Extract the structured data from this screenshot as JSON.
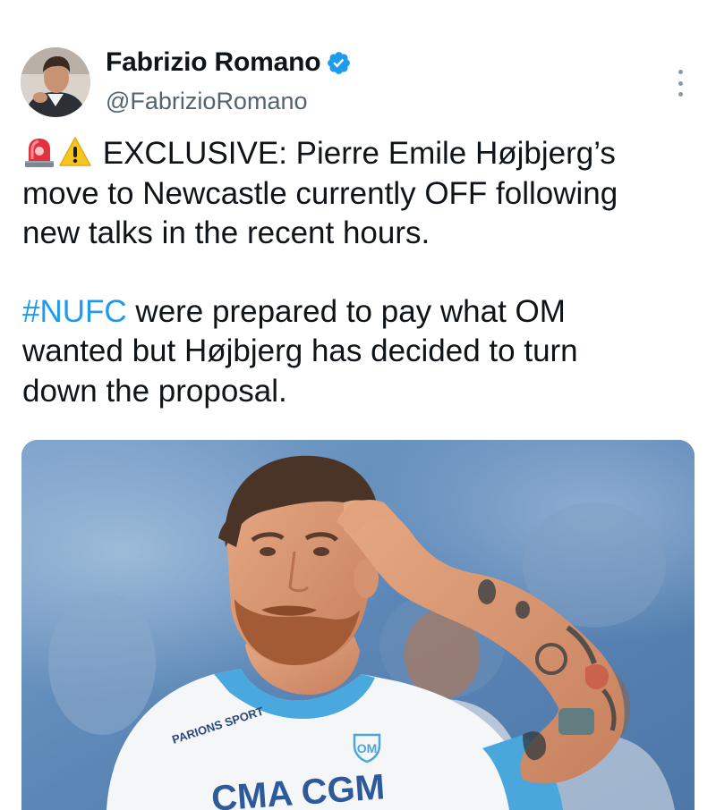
{
  "author": {
    "display_name": "Fabrizio Romano",
    "handle": "@FabrizioRomano",
    "verified": true,
    "verified_color": "#1d9bf0"
  },
  "icons": {
    "avatar": "profile-photo",
    "verified": "verified-badge-icon",
    "more": "more-options-icon",
    "emoji_1": "rotating-light-emoji",
    "emoji_2": "warning-emoji"
  },
  "tweet": {
    "line_1": "EXCLUSIVE: Pierre Emile Højbjerg’s",
    "line_2": "move to Newcastle currently OFF following",
    "line_3": "new talks in the recent hours.",
    "hashtag": "#NUFC",
    "line_4_rest": " were prepared to pay what OM",
    "line_5": "wanted but Højbjerg has decided to turn",
    "line_6": "down the proposal.",
    "hashtag_color": "#1d9bf0"
  },
  "media": {
    "kit_sponsor": "CMA CGM",
    "sleeve_sponsor": "PARIONS SPORT",
    "club_crest": "OM"
  }
}
